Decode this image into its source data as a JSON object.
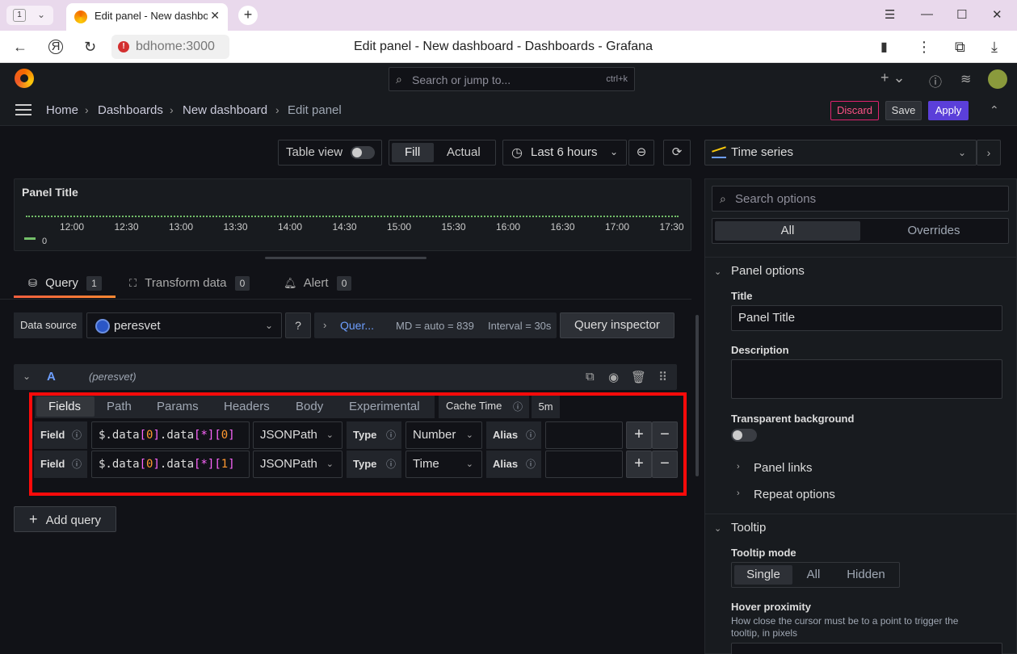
{
  "browser": {
    "tab_count": "1",
    "tab_title": "Edit panel - New dashboard - Dashboards - Grafana",
    "url_host": "bdhome:3000",
    "page_title": "Edit panel - New dashboard - Dashboards - Grafana"
  },
  "topbar": {
    "search_placeholder": "Search or jump to...",
    "search_shortcut": "ctrl+k"
  },
  "breadcrumb": {
    "items": [
      "Home",
      "Dashboards",
      "New dashboard",
      "Edit panel"
    ]
  },
  "actions": {
    "discard": "Discard",
    "save": "Save",
    "apply": "Apply"
  },
  "toolbar": {
    "table_view": "Table view",
    "fill": "Fill",
    "actual": "Actual",
    "time_range": "Last 6 hours"
  },
  "panel": {
    "title": "Panel Title",
    "x_ticks": [
      "12:00",
      "12:30",
      "13:00",
      "13:30",
      "14:00",
      "14:30",
      "15:00",
      "15:30",
      "16:00",
      "16:30",
      "17:00",
      "17:30"
    ],
    "legend_value": "0",
    "series_color": "#73bf69"
  },
  "query_tabs": [
    {
      "label": "Query",
      "count": "1"
    },
    {
      "label": "Transform data",
      "count": "0"
    },
    {
      "label": "Alert",
      "count": "0"
    }
  ],
  "datasource": {
    "label": "Data source",
    "name": "peresvet",
    "query_options_link": "Quer...",
    "md": "MD = auto = 839",
    "interval": "Interval = 30s",
    "inspector": "Query inspector"
  },
  "query": {
    "ref": "A",
    "ds": "(peresvet)",
    "tabs": [
      "Fields",
      "Path",
      "Params",
      "Headers",
      "Body",
      "Experimental"
    ],
    "cache_time_label": "Cache Time",
    "cache_time_value": "5m",
    "fields": [
      {
        "label": "Field",
        "parts": [
          "$.data",
          "[",
          "0",
          "]",
          ".data",
          "[",
          "*",
          "]",
          "[",
          "0",
          "]"
        ],
        "lang": "JSONPath",
        "type_label": "Type",
        "type": "Number",
        "alias_label": "Alias",
        "alias": ""
      },
      {
        "label": "Field",
        "parts": [
          "$.data",
          "[",
          "0",
          "]",
          ".data",
          "[",
          "*",
          "]",
          "[",
          "1",
          "]"
        ],
        "lang": "JSONPath",
        "type_label": "Type",
        "type": "Time",
        "alias_label": "Alias",
        "alias": ""
      }
    ],
    "add_query": "Add query"
  },
  "options": {
    "viz": "Time series",
    "search_placeholder": "Search options",
    "tab_all": "All",
    "tab_overrides": "Overrides",
    "panel_options": "Panel options",
    "title_label": "Title",
    "title_value": "Panel Title",
    "description_label": "Description",
    "transparent_label": "Transparent background",
    "panel_links": "Panel links",
    "repeat_options": "Repeat options",
    "tooltip": "Tooltip",
    "tooltip_mode_label": "Tooltip mode",
    "tooltip_modes": [
      "Single",
      "All",
      "Hidden"
    ],
    "hover_label": "Hover proximity",
    "hover_desc": "How close the cursor must be to a point to trigger the tooltip, in pixels"
  }
}
